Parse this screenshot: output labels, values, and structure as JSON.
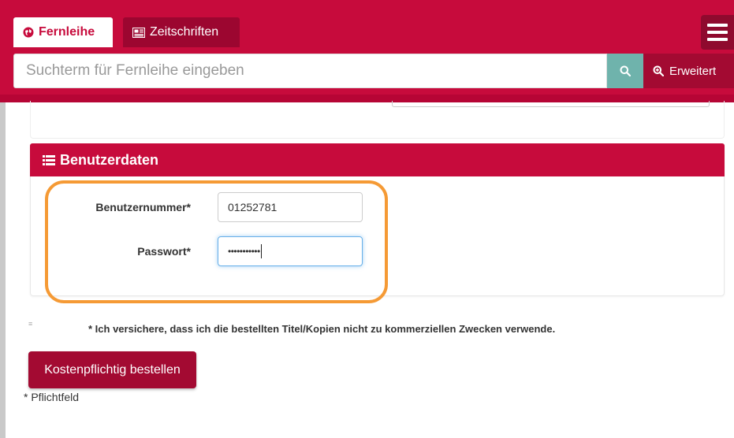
{
  "header": {
    "tabs": [
      {
        "label": "Fernleihe",
        "icon": "globe-icon",
        "active": true
      },
      {
        "label": "Zeitschriften",
        "icon": "newspaper-icon",
        "active": false
      }
    ],
    "menu_icon": "hamburger-menu-icon"
  },
  "search": {
    "placeholder": "Suchterm für Fernleihe eingeben",
    "value": "",
    "search_icon": "search-icon",
    "advanced_label": "Erweitert",
    "advanced_icon": "zoom-in-icon"
  },
  "user_panel": {
    "title": "Benutzerdaten",
    "title_icon": "list-icon",
    "fields": [
      {
        "label": "Benutzernummer*",
        "value": "01252781"
      },
      {
        "label": "Passwort*",
        "value": "•••••••••••"
      }
    ]
  },
  "agreement": {
    "text": "* Ich versichere, dass ich die bestellten Titel/Kopien nicht zu kommerziellen Zwecken verwende."
  },
  "order_button": {
    "label": "Kostenpflichtig bestellen"
  },
  "required_note": "* Pflichtfeld",
  "colors": {
    "brand": "#c70b3c",
    "brand_dark": "#a30a32",
    "search_button": "#6fb3ac",
    "highlight": "#f59a35"
  }
}
